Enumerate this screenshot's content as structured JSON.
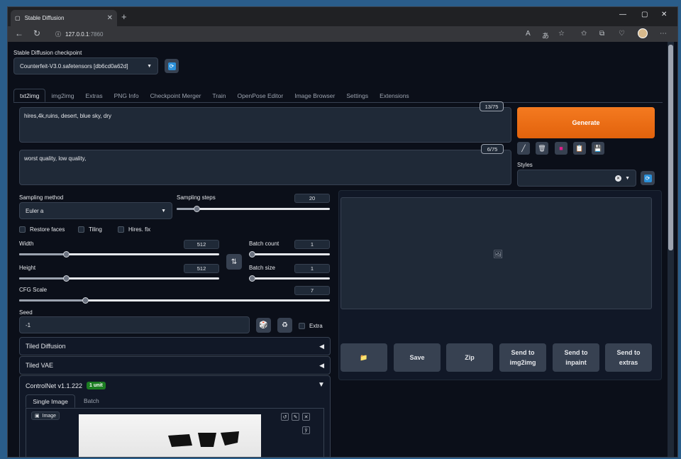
{
  "browser": {
    "tab_title": "Stable Diffusion",
    "url_host": "127.0.0.1",
    "url_port": ":7860"
  },
  "checkpoint": {
    "label": "Stable Diffusion checkpoint",
    "value": "Counterfeit-V3.0.safetensors [db6cd0a62d]"
  },
  "tabs": [
    {
      "label": "txt2img"
    },
    {
      "label": "img2img"
    },
    {
      "label": "Extras"
    },
    {
      "label": "PNG Info"
    },
    {
      "label": "Checkpoint Merger"
    },
    {
      "label": "Train"
    },
    {
      "label": "OpenPose Editor"
    },
    {
      "label": "Image Browser"
    },
    {
      "label": "Settings"
    },
    {
      "label": "Extensions"
    }
  ],
  "prompt": {
    "positive": "hires,4k,ruins, desert, blue sky, dry",
    "positive_tokens": "13/75",
    "negative": "worst quality, low quality,",
    "negative_tokens": "6/75"
  },
  "generate_label": "Generate",
  "styles_label": "Styles",
  "sampling": {
    "method_label": "Sampling method",
    "method_value": "Euler a",
    "steps_label": "Sampling steps",
    "steps_value": "20",
    "steps_fraction": 0.13
  },
  "checkboxes": {
    "restore_faces": "Restore faces",
    "tiling": "Tiling",
    "hires_fix": "Hires. fix"
  },
  "size": {
    "width_label": "Width",
    "width_value": "512",
    "height_label": "Height",
    "height_value": "512",
    "batch_count_label": "Batch count",
    "batch_count_value": "1",
    "batch_size_label": "Batch size",
    "batch_size_value": "1"
  },
  "cfg": {
    "label": "CFG Scale",
    "value": "7"
  },
  "seed": {
    "label": "Seed",
    "value": "-1",
    "extra_label": "Extra"
  },
  "accordions": {
    "tiled_diffusion": "Tiled Diffusion",
    "tiled_vae": "Tiled VAE",
    "controlnet": "ControlNet v1.1.222",
    "controlnet_badge": "1 unit"
  },
  "controlnet_tabs": {
    "single": "Single Image",
    "batch": "Batch"
  },
  "image_label": "Image",
  "output_buttons": {
    "folder": "📁",
    "save": "Save",
    "zip": "Zip",
    "send_img2img": "Send to img2img",
    "send_inpaint": "Send to inpaint",
    "send_extras": "Send to extras"
  },
  "colors": {
    "generate": "#f47a20",
    "background": "#0b0f19",
    "badge": "#1c7d22"
  }
}
